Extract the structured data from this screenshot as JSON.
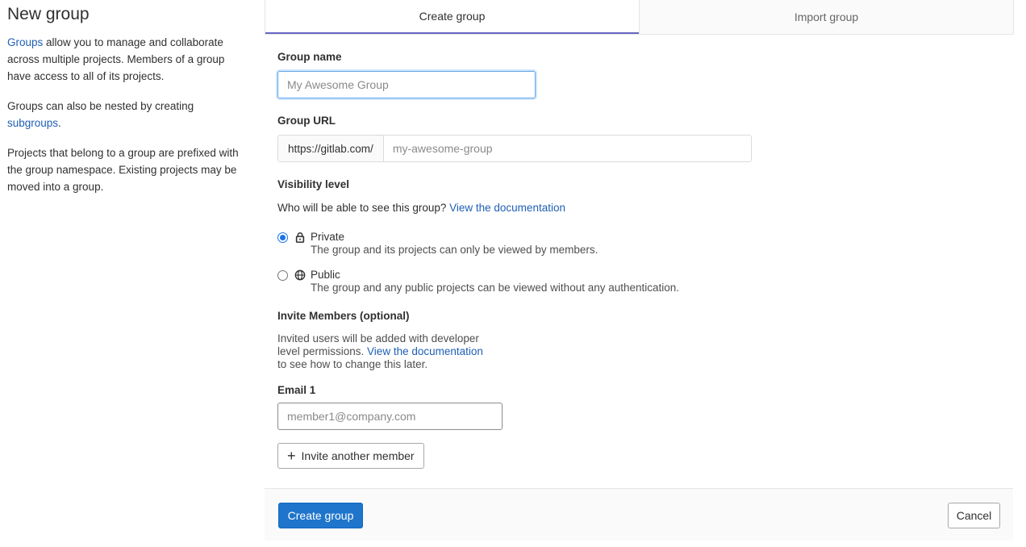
{
  "page_title": "New group",
  "sidebar": {
    "p1_link": "Groups",
    "p1_text": " allow you to manage and collaborate across multiple projects. Members of a group have access to all of its projects.",
    "p2_text": "Groups can also be nested by creating ",
    "p2_link": "subgroups",
    "p2_end": ".",
    "p3_text": "Projects that belong to a group are prefixed with the group namespace. Existing projects may be moved into a group."
  },
  "tabs": [
    {
      "label": "Create group",
      "active": true
    },
    {
      "label": "Import group",
      "active": false
    }
  ],
  "form": {
    "group_name_label": "Group name",
    "group_name_placeholder": "My Awesome Group",
    "group_url_label": "Group URL",
    "url_prefix": "https://gitlab.com/",
    "url_placeholder": "my-awesome-group",
    "visibility_label": "Visibility level",
    "visibility_question": "Who will be able to see this group? ",
    "visibility_link": "View the documentation",
    "visibility_options": [
      {
        "title": "Private",
        "desc": "The group and its projects can only be viewed by members.",
        "checked": true,
        "icon": "lock-icon"
      },
      {
        "title": "Public",
        "desc": "The group and any public projects can be viewed without any authentication.",
        "checked": false,
        "icon": "globe-icon"
      }
    ],
    "invite_label": "Invite Members (optional)",
    "invite_line1": "Invited users will be added with developer",
    "invite_line2": "level permissions. ",
    "invite_link": "View the documentation",
    "invite_line3": "to see how to change this later.",
    "email_label": "Email 1",
    "email_placeholder": "member1@company.com",
    "invite_another_label": "Invite another member"
  },
  "footer": {
    "create_label": "Create group",
    "cancel_label": "Cancel"
  },
  "colors": {
    "primary": "#1f75cb",
    "link": "#1f5fb4",
    "tab_active_border": "#6666c4"
  }
}
